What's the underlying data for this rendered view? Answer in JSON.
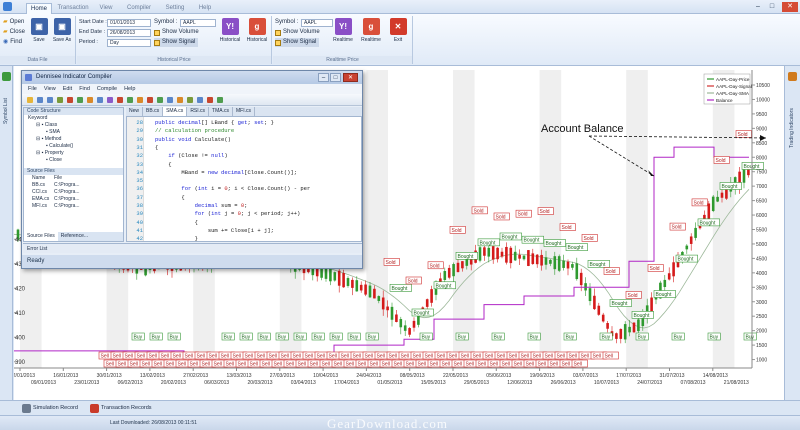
{
  "main_tabs": [
    "Home",
    "Transaction",
    "View",
    "Compiler",
    "Setting",
    "Help"
  ],
  "ribbon": {
    "data_file": {
      "items": [
        "Open",
        "Close",
        "Find"
      ],
      "save": "Save",
      "save_as": "Save As",
      "group_label": "Data File"
    },
    "historical": {
      "start_label": "Start Date :",
      "start_value": "01/01/2013",
      "end_label": "End Date :",
      "end_value": "26/08/2013",
      "period_label": "Period :",
      "period_value": "Day",
      "symbol_label": "Symbol :",
      "symbol_value": "AAPL",
      "show_volume": "Show Volume",
      "show_signal": "Show Signal",
      "btn1": "Historical",
      "btn2": "Historical",
      "group_label": "Historical Price"
    },
    "realtime": {
      "symbol_label": "Symbol :",
      "symbol_value": "AAPL",
      "show_volume": "Show Volume",
      "show_signal": "Show Signal",
      "btn1": "Realtime",
      "btn2": "Realtime",
      "exit": "Exit",
      "group_label": "Realtime Price"
    }
  },
  "left_strip_label": "Symbol List",
  "right_strip_label": "Trading Indicators",
  "compiler": {
    "title": "Dennisee Indicator Compiler",
    "menu": [
      "File",
      "View",
      "Edit",
      "Find",
      "Compile",
      "Help"
    ],
    "code_structure": {
      "header": "Code Structure",
      "keyword_label": "Keyword",
      "rows": [
        "Class",
        "SMA",
        "Method",
        "Calculate()",
        "Property",
        "Close"
      ]
    },
    "source_files": {
      "header": "Source Files",
      "col_name": "Name",
      "col_file": "File",
      "rows": [
        [
          "BB.cs",
          "C:\\Progra..."
        ],
        [
          "CCI.cs",
          "C:\\Progra..."
        ],
        [
          "EMA.cs",
          "C:\\Progra..."
        ],
        [
          "MFI.cs",
          "C:\\Progra..."
        ]
      ]
    },
    "left_tabs": [
      "Source Files",
      "Reference..."
    ],
    "editor_tabs": [
      "New",
      "BB.cs",
      "SMA.cs",
      "RSI.cs",
      "TMA.cs",
      "MFI.cs"
    ],
    "line_numbers": [
      "28",
      "29",
      "30",
      "31",
      "32",
      "33",
      "34",
      "35",
      "36",
      "37",
      "38",
      "39",
      "40",
      "41",
      "42"
    ],
    "code_lines": [
      "public decimal[] LBand { get; set; }",
      "// calculation procedure",
      "public void Calculate()",
      "{",
      "    if (Close != null)",
      "    {",
      "        MBand = new decimal[Close.Count()];",
      "",
      "        for (int i = 0; i < Close.Count() - per",
      "        {",
      "            decimal sum = 0;",
      "            for (int j = 0; j < period; j++)",
      "            {",
      "                sum += Close[i + j];",
      "            }"
    ],
    "error_list": "Error List",
    "status": "Ready"
  },
  "chart_data": {
    "type": "line",
    "series": [
      {
        "name": "AAPL-Day-Price"
      },
      {
        "name": "AAPL-Day-Signal"
      },
      {
        "name": "AAPL-Day-SMA"
      },
      {
        "name": "Balance"
      }
    ],
    "y_ticks": [
      "390",
      "400",
      "410",
      "420",
      "430",
      "440"
    ],
    "balance_ticks": [
      "1000",
      "1500",
      "2000",
      "2500",
      "3000",
      "3500",
      "4000",
      "4500",
      "5000",
      "5500",
      "6000",
      "6500",
      "7000",
      "7500",
      "8000",
      "8500",
      "9000",
      "9500",
      "10000",
      "10500"
    ],
    "x_ticks_top": [
      "02/01/2013",
      "16/01/2013",
      "30/01/2013",
      "13/02/2013",
      "27/02/2013",
      "13/03/2013",
      "27/03/2013",
      "10/04/2013",
      "24/04/2013",
      "08/05/2013",
      "22/05/2013",
      "05/06/2013",
      "19/06/2013",
      "03/07/2013",
      "17/07/2013",
      "31/07/2013",
      "14/08/2013"
    ],
    "x_ticks_bottom": [
      "09/01/2013",
      "23/01/2013",
      "06/02/2013",
      "20/02/2013",
      "06/03/2013",
      "20/03/2013",
      "03/04/2013",
      "17/04/2013",
      "01/05/2013",
      "15/05/2013",
      "29/05/2013",
      "12/06/2013",
      "26/06/2013",
      "10/07/2013",
      "24/07/2013",
      "07/08/2013",
      "21/08/2013"
    ],
    "annotation": "Account Balance",
    "signal_labels": {
      "buy": "Buy",
      "sell": "Sell",
      "bought": "Bought",
      "sold": "Sold"
    }
  },
  "bottom_tabs": [
    "Simulation Record",
    "Transaction Records"
  ],
  "status": {
    "last_downloaded": "Last Downloaded: 26/08/2013 00:11:51"
  },
  "watermark": "GearDownload.com",
  "colors": {
    "balance": "#b026c6",
    "sma": "#9db89a",
    "up": "#2f9a2f",
    "down": "#d51a1a"
  }
}
